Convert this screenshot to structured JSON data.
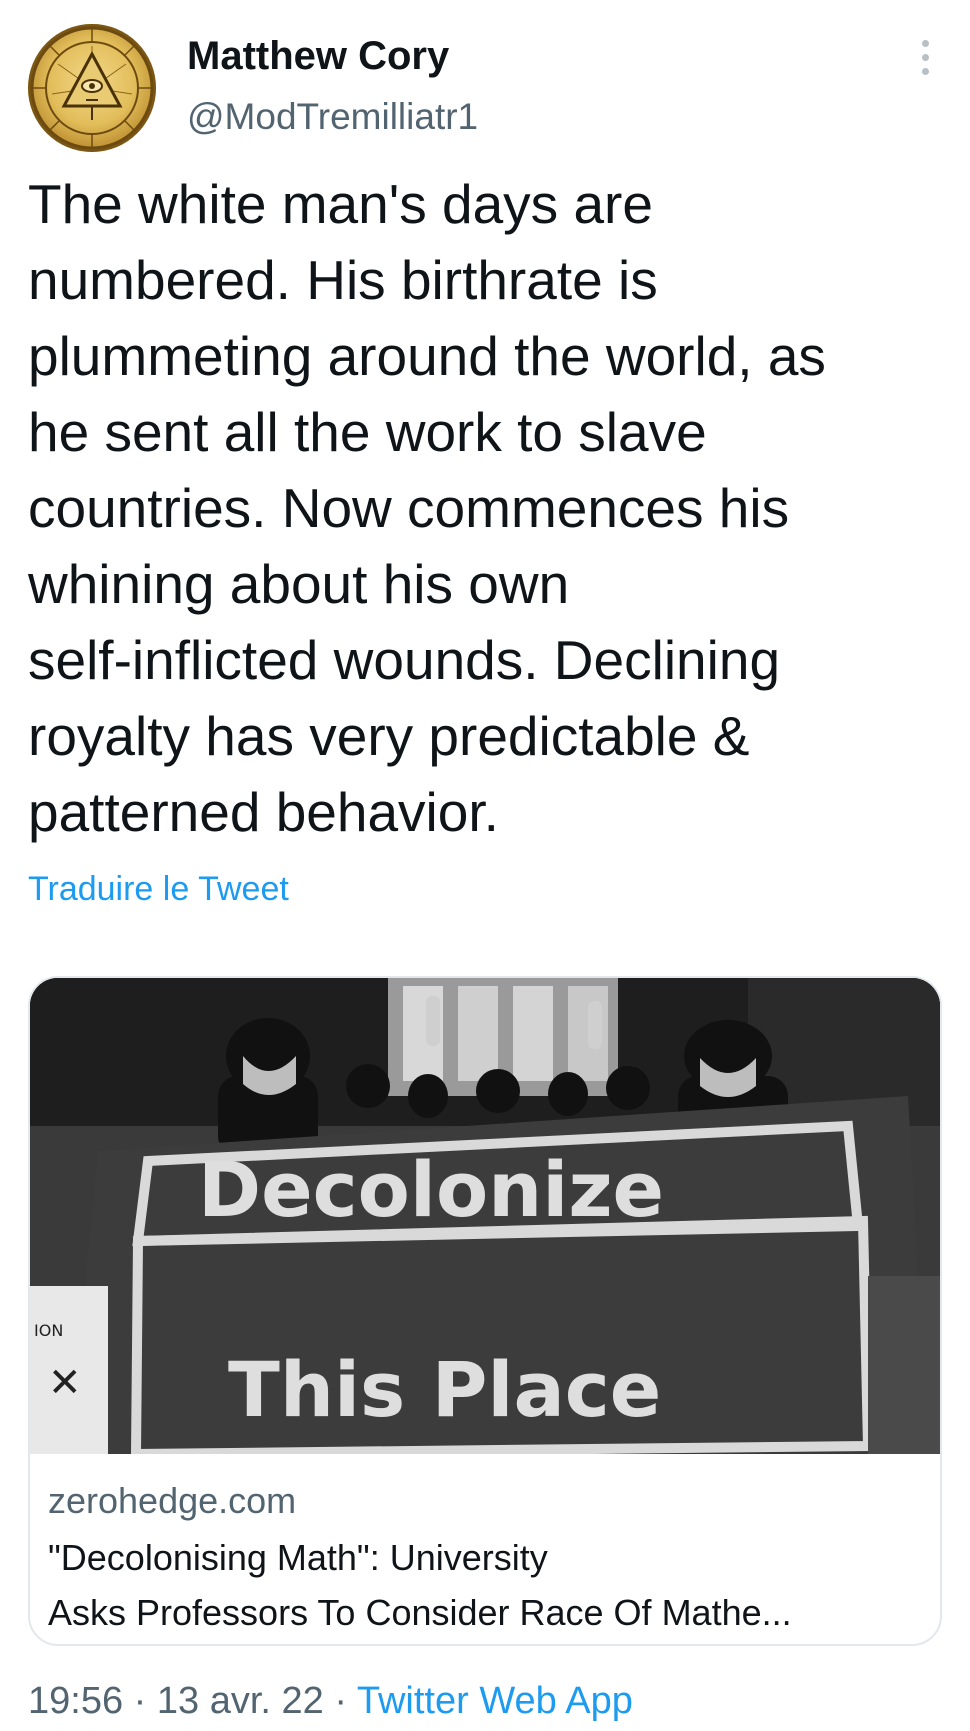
{
  "author": {
    "name": "Matthew Cory",
    "handle": "@ModTremilliatr1",
    "avatar_icon": "gold-illuminati-coin-avatar"
  },
  "tweet": {
    "text": "The white man's days are\nnumbered. His birthrate is\nplummeting around the world, as\nhe sent all the work to slave\ncountries. Now commences his\nwhining about his own\nself-inflicted wounds. Declining\nroyalty has very predictable &\npatterned behavior.",
    "translate_label": "Traduire le Tweet"
  },
  "card": {
    "image_banner_line1": "Decolonize",
    "image_banner_line2": "This Place",
    "domain": "zerohedge.com",
    "title": "\"Decolonising Math\": University\nAsks Professors To Consider Race Of Mathe..."
  },
  "meta": {
    "time": "19:56",
    "separator1": " · ",
    "date": "13 avr. 22",
    "separator2": " · ",
    "app": "Twitter Web App"
  },
  "colors": {
    "text_primary": "#0f1419",
    "text_secondary": "#536471",
    "link": "#1d9bf0",
    "border": "#e3e8ec"
  },
  "icons": {
    "more": "more-vertical-icon"
  }
}
